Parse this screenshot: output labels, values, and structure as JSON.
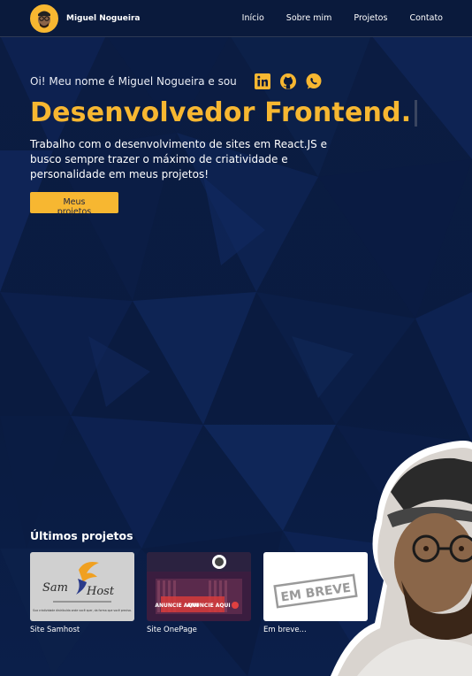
{
  "header": {
    "brand_name": "Miguel Nogueira",
    "nav": [
      "Início",
      "Sobre mim",
      "Projetos",
      "Contato"
    ]
  },
  "hero": {
    "intro": "Oi! Meu nome é Miguel Nogueira e sou",
    "socials": [
      "linkedin-icon",
      "github-icon",
      "whatsapp-icon"
    ],
    "headline": "Desenvolvedor Frontend.",
    "description": "Trabalho com o desenvolvimento de sites em React.JS e busco sempre trazer o máximo de criatividade e personalidade em meus projetos!",
    "cta": "Meus projetos"
  },
  "projects": {
    "title": "Últimos projetos",
    "items": [
      {
        "label": "Site Samhost",
        "logo_text_1": "Sam",
        "logo_text_2": "Host",
        "tagline": "Sua criatividade distribuída onde você quer, da forma que você precisa."
      },
      {
        "label": "Site OnePage",
        "banner_1": "ANUNCIE AQUI",
        "banner_2": "ANUNCIE AQUI"
      },
      {
        "label": "Em breve...",
        "stamp": "EM BREVE"
      }
    ]
  },
  "colors": {
    "accent": "#f7b731",
    "background": "#0a1a3d"
  }
}
